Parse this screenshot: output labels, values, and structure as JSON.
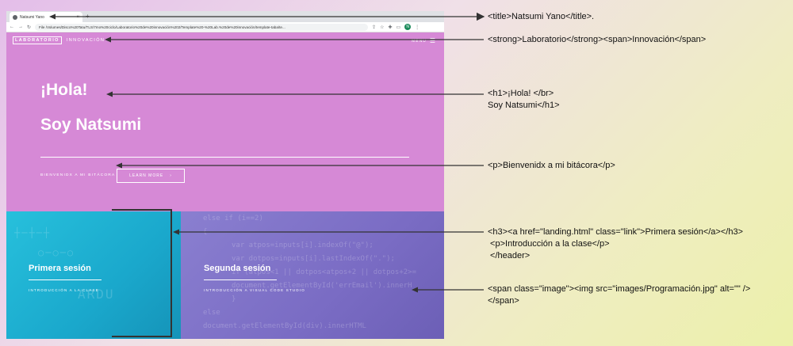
{
  "browser": {
    "tab_title": "Natsumi Yano",
    "tab_close": "×",
    "tab_new": "+",
    "url_label": "File",
    "url": "/Volumes/Disco%20Tatu/TLS/7mo%20ciclo/Laboratorio%20de%20innovación%202/Template%20-%20Lab.%20de%20innovación/template-taba/te..."
  },
  "page": {
    "brand_strong": "LABORATORIO",
    "brand_span": "INNOVACIÓN",
    "menu_label": "MENU",
    "hola": "¡Hola!",
    "soy": "Soy Natsumi",
    "bienvenidx": "BIENVENIDX A MI BITÁCORA",
    "learn_button": "LEARN MORE",
    "learn_arrow": "›",
    "tile1": {
      "title": "Primera sesión",
      "subtitle": "INTRODUCCIÓN A LA CLASE",
      "bg_text": "ARDU"
    },
    "tile2": {
      "title": "Segunda sesión",
      "subtitle": "INTRODUCCIÓN A VISUAL CODE STUDIO"
    },
    "code_lines": [
      "else if (i==2)",
      "{",
      "  var atpos=inputs[i].indexOf(\"@\");",
      "  var dotpos=inputs[i].lastIndexOf(\".\");",
      "  if (atpos<1 || dotpos<atpos+2 || dotpos+2>=",
      "    document.getElementById('errEmail').innerH",
      "  }",
      "  else",
      "    document.getElementById(div).innerHTML"
    ]
  },
  "annotations": {
    "title": "<title>Natsumi Yano</title>.",
    "brand": "<strong>Laboratorio</strong><span>Innovación</span>",
    "h1_line1": "<h1>¡Hola! </br>",
    "h1_line2": "Soy Natsumi</h1>",
    "p": "<p>Bienvenidx a mi bitácora</p>",
    "h3_line1": "<h3><a href=\"landing.html\" class=\"link\">Primera sesión</a></h3>",
    "h3_line2": " <p>Introducción a la clase</p>",
    "h3_line3": " </header>",
    "img_line1": "<span class=\"image\"><img src=\"images/Programación.jpg\" alt=\"\" />",
    "img_line2": "</span>"
  },
  "colors": {
    "hero": "#d689d6",
    "tile1": "#1fb4d6",
    "tile2": "#7f73c9",
    "arrow": "#333333"
  }
}
